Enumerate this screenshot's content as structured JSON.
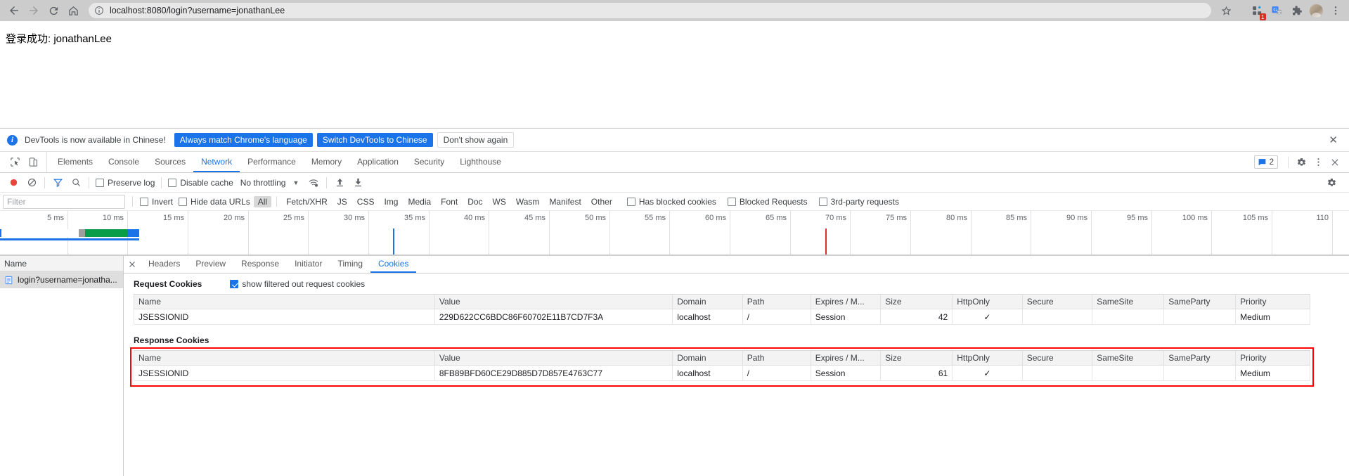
{
  "browser": {
    "back_icon": "back-arrow-icon",
    "forward_icon": "forward-arrow-icon",
    "reload_icon": "reload-icon",
    "home_icon": "home-icon",
    "site_info_icon": "info-circle-icon",
    "url": "localhost:8080/login?username=jonathanLee",
    "star_icon": "star-icon",
    "extensions_icon": "extensions-puzzle-grid-icon",
    "extensions_badge": "1",
    "translate_icon": "google-translate-icon",
    "puzzle_icon": "puzzle-piece-icon",
    "avatar_icon": "profile-avatar-icon",
    "menu_icon": "three-dot-menu-icon"
  },
  "page": {
    "text": "登录成功: jonathanLee"
  },
  "lang_bar": {
    "info_icon": "info-icon",
    "message": "DevTools is now available in Chinese!",
    "btn_always_match": "Always match Chrome's language",
    "btn_switch": "Switch DevTools to Chinese",
    "btn_dont_show": "Don't show again",
    "close_icon": "close-icon"
  },
  "devtools": {
    "inspect_icon": "inspect-element-icon",
    "device_icon": "toggle-device-toolbar-icon",
    "tabs": [
      {
        "label": "Elements",
        "active": false
      },
      {
        "label": "Console",
        "active": false
      },
      {
        "label": "Sources",
        "active": false
      },
      {
        "label": "Network",
        "active": true
      },
      {
        "label": "Performance",
        "active": false
      },
      {
        "label": "Memory",
        "active": false
      },
      {
        "label": "Application",
        "active": false
      },
      {
        "label": "Security",
        "active": false
      },
      {
        "label": "Lighthouse",
        "active": false
      }
    ],
    "message_count": "2",
    "message_icon": "message-bubble-icon",
    "settings_icon": "gear-icon",
    "more_icon": "three-dot-menu-icon",
    "close_icon": "close-icon"
  },
  "network_toolbar": {
    "record_icon": "record-circle-icon",
    "clear_icon": "clear-no-entry-icon",
    "filter_icon": "filter-funnel-icon",
    "search_icon": "search-icon",
    "preserve_log_label": "Preserve log",
    "preserve_log_checked": false,
    "disable_cache_label": "Disable cache",
    "disable_cache_checked": false,
    "throttling_label": "No throttling",
    "caret_icon": "chevron-down-icon",
    "network_conditions_icon": "wifi-settings-icon",
    "import_icon": "upload-arrow-icon",
    "export_icon": "download-arrow-icon",
    "settings_icon": "gear-icon"
  },
  "filter_row": {
    "filter_placeholder": "Filter",
    "filter_value": "",
    "invert_label": "Invert",
    "invert_checked": false,
    "hide_data_urls_label": "Hide data URLs",
    "hide_data_urls_checked": false,
    "types": [
      {
        "label": "All",
        "active": true
      },
      {
        "label": "Fetch/XHR",
        "active": false
      },
      {
        "label": "JS",
        "active": false
      },
      {
        "label": "CSS",
        "active": false
      },
      {
        "label": "Img",
        "active": false
      },
      {
        "label": "Media",
        "active": false
      },
      {
        "label": "Font",
        "active": false
      },
      {
        "label": "Doc",
        "active": false
      },
      {
        "label": "WS",
        "active": false
      },
      {
        "label": "Wasm",
        "active": false
      },
      {
        "label": "Manifest",
        "active": false
      },
      {
        "label": "Other",
        "active": false
      }
    ],
    "has_blocked_cookies_label": "Has blocked cookies",
    "has_blocked_cookies_checked": false,
    "blocked_requests_label": "Blocked Requests",
    "blocked_requests_checked": false,
    "third_party_label": "3rd-party requests",
    "third_party_checked": false
  },
  "overview": {
    "ticks": [
      "5 ms",
      "10 ms",
      "15 ms",
      "20 ms",
      "25 ms",
      "30 ms",
      "35 ms",
      "40 ms",
      "45 ms",
      "50 ms",
      "55 ms",
      "60 ms",
      "65 ms",
      "70 ms",
      "75 ms",
      "80 ms",
      "85 ms",
      "90 ms",
      "95 ms",
      "100 ms",
      "105 ms",
      "110"
    ],
    "dom_content_loaded_color": "#1a73e8",
    "load_event_color": "#d93025",
    "bar_colors": {
      "queue": "#1a73e8",
      "stalled": "#9e9e9e",
      "waiting": "#0a9d49",
      "download": "#1a73e8"
    }
  },
  "request_list": {
    "column_header": "Name",
    "rows": [
      {
        "name": "login?username=jonatha...",
        "icon": "document-icon",
        "selected": true
      }
    ]
  },
  "detail_panel": {
    "close_icon": "close-icon",
    "tabs": [
      {
        "label": "Headers",
        "active": false
      },
      {
        "label": "Preview",
        "active": false
      },
      {
        "label": "Response",
        "active": false
      },
      {
        "label": "Initiator",
        "active": false
      },
      {
        "label": "Timing",
        "active": false
      },
      {
        "label": "Cookies",
        "active": true
      }
    ]
  },
  "cookies": {
    "request_section_title": "Request Cookies",
    "show_filtered_label": "show filtered out request cookies",
    "show_filtered_checked": true,
    "response_section_title": "Response Cookies",
    "columns": [
      "Name",
      "Value",
      "Domain",
      "Path",
      "Expires / M...",
      "Size",
      "HttpOnly",
      "Secure",
      "SameSite",
      "SameParty",
      "Priority"
    ],
    "request_rows": [
      {
        "name": "JSESSIONID",
        "value": "229D622CC6BDC86F60702E11B7CD7F3A",
        "domain": "localhost",
        "path": "/",
        "expires": "Session",
        "size": "42",
        "httponly": "✓",
        "secure": "",
        "samesite": "",
        "sameparty": "",
        "priority": "Medium"
      }
    ],
    "response_rows": [
      {
        "name": "JSESSIONID",
        "value": "8FB89BFD60CE29D885D7D857E4763C77",
        "domain": "localhost",
        "path": "/",
        "expires": "Session",
        "size": "61",
        "httponly": "✓",
        "secure": "",
        "samesite": "",
        "sameparty": "",
        "priority": "Medium"
      }
    ],
    "highlight_color": "#ff0000"
  }
}
